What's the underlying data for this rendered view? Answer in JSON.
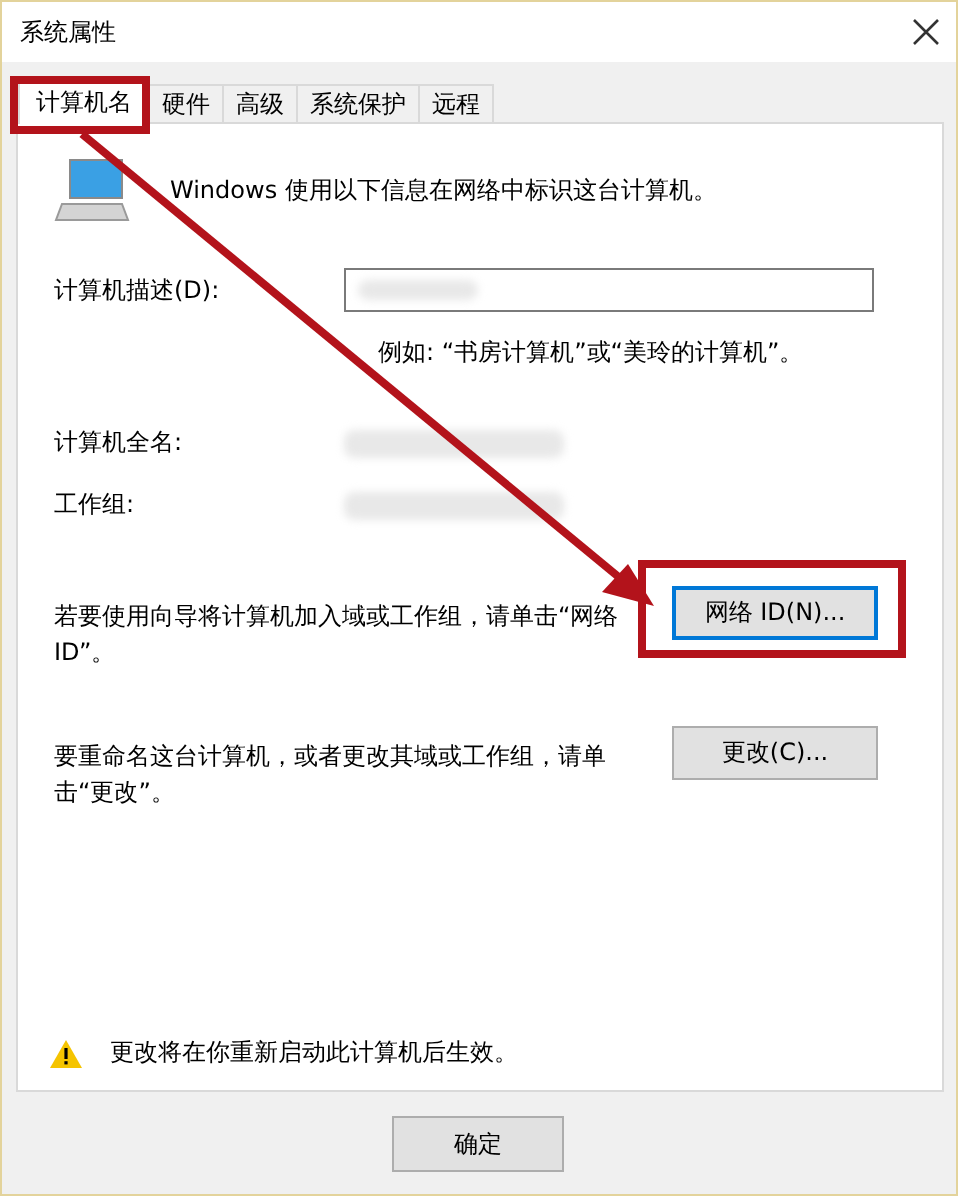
{
  "window": {
    "title": "系统属性"
  },
  "tabs": [
    {
      "label": "计算机名",
      "selected": true
    },
    {
      "label": "硬件",
      "selected": false
    },
    {
      "label": "高级",
      "selected": false
    },
    {
      "label": "系统保护",
      "selected": false
    },
    {
      "label": "远程",
      "selected": false
    }
  ],
  "intro": "Windows 使用以下信息在网络中标识这台计算机。",
  "description": {
    "label": "计算机描述(D):",
    "hint": "例如: “书房计算机”或“美玲的计算机”。"
  },
  "full_name": {
    "label": "计算机全名:"
  },
  "workgroup": {
    "label": "工作组:"
  },
  "network_id": {
    "text": "若要使用向导将计算机加入域或工作组，请单击“网络 ID”。",
    "button": "网络 ID(N)...",
    "focused": true
  },
  "rename": {
    "text": "要重命名这台计算机，或者更改其域或工作组，请单击“更改”。",
    "button": "更改(C)...",
    "focused": false
  },
  "notice": "更改将在你重新启动此计算机后生效。",
  "buttons": [
    "确定"
  ]
}
